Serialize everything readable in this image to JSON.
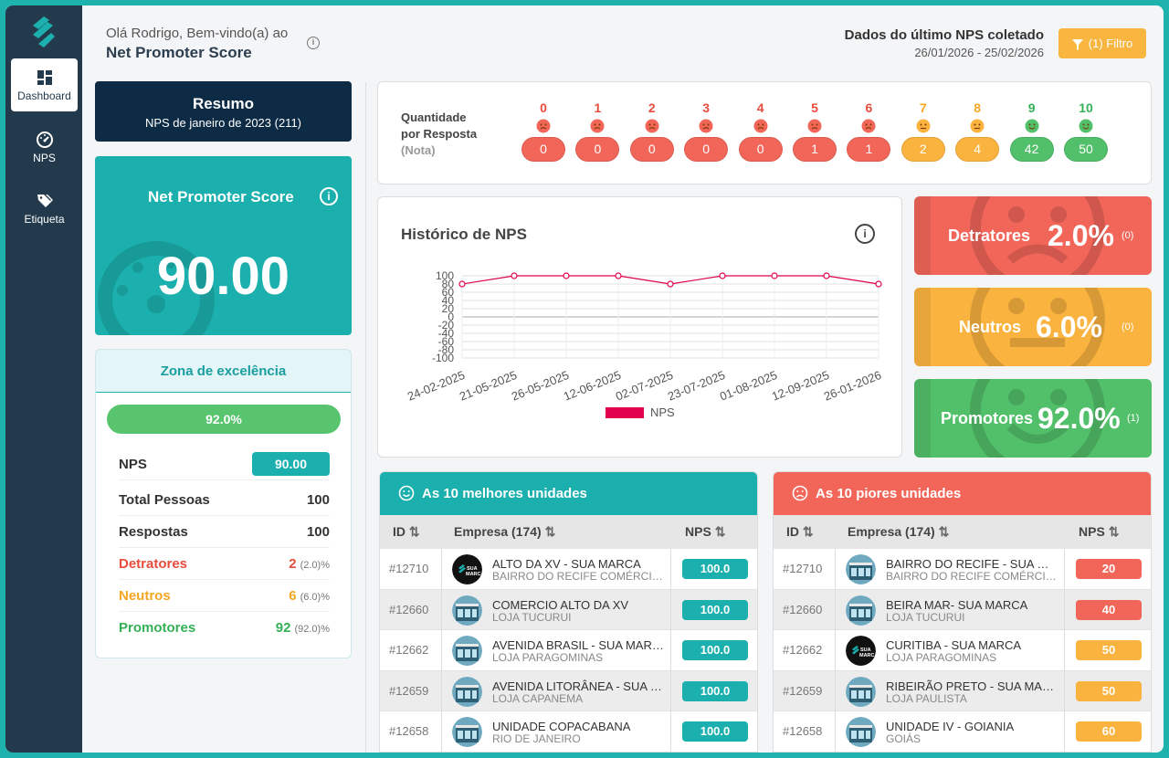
{
  "sidebar": {
    "items": [
      {
        "label": "Dashboard",
        "icon": "dashboard-icon"
      },
      {
        "label": "NPS",
        "icon": "gauge-icon"
      },
      {
        "label": "Etiqueta",
        "icon": "tag-icon"
      }
    ]
  },
  "header": {
    "greeting": "Olá Rodrigo, Bem-vindo(a) ao",
    "title": "Net Promoter Score",
    "last_nps_title": "Dados do último NPS coletado",
    "last_nps_range": "26/01/2026 - 25/02/2026",
    "filter_label": "(1) Filtro"
  },
  "resumo": {
    "title": "Resumo",
    "subtitle": "NPS de janeiro de 2023 (211)"
  },
  "nps_card": {
    "title": "Net Promoter Score",
    "value": "90.00",
    "info": "i"
  },
  "zona": {
    "title": "Zona de excelência",
    "progress_label": "92.0%",
    "progress": 0.92,
    "rows": {
      "nps": {
        "label": "NPS",
        "value": "90.00"
      },
      "total": {
        "label": "Total Pessoas",
        "value": "100"
      },
      "respostas": {
        "label": "Respostas",
        "value": "100"
      },
      "detratores": {
        "label": "Detratores",
        "value": "2",
        "pct": "(2.0)%"
      },
      "neutros": {
        "label": "Neutros",
        "value": "6",
        "pct": "(6.0)%"
      },
      "promotores": {
        "label": "Promotores",
        "value": "92",
        "pct": "(92.0)%"
      }
    }
  },
  "quantidade": {
    "label_line1": "Quantidade",
    "label_line2": "por Resposta",
    "label_line3": "(Nota)",
    "notes": [
      {
        "note": "0",
        "count": "0",
        "group": "red"
      },
      {
        "note": "1",
        "count": "0",
        "group": "red"
      },
      {
        "note": "2",
        "count": "0",
        "group": "red"
      },
      {
        "note": "3",
        "count": "0",
        "group": "red"
      },
      {
        "note": "4",
        "count": "0",
        "group": "red"
      },
      {
        "note": "5",
        "count": "1",
        "group": "red"
      },
      {
        "note": "6",
        "count": "1",
        "group": "red"
      },
      {
        "note": "7",
        "count": "2",
        "group": "yellow"
      },
      {
        "note": "8",
        "count": "4",
        "group": "yellow"
      },
      {
        "note": "9",
        "count": "42",
        "group": "green"
      },
      {
        "note": "10",
        "count": "50",
        "group": "green"
      }
    ]
  },
  "historico": {
    "title": "Histórico de NPS",
    "info": "i"
  },
  "chart_data": {
    "type": "line",
    "x": [
      "24-02-2025",
      "21-05-2025",
      "26-05-2025",
      "12-06-2025",
      "02-07-2025",
      "23-07-2025",
      "01-08-2025",
      "12-09-2025",
      "26-01-2026"
    ],
    "series": [
      {
        "name": "NPS",
        "values": [
          80,
          100,
          100,
          100,
          80,
          100,
          100,
          100,
          80
        ]
      }
    ],
    "yticks": [
      100,
      80,
      60,
      40,
      20,
      0,
      -20,
      -40,
      -60,
      -80,
      -100
    ],
    "ylim": [
      -100,
      100
    ],
    "grid": true,
    "legend": "bottom",
    "color": "#e0004d"
  },
  "stats": {
    "detratores": {
      "label": "Detratores",
      "pct": "2.0%",
      "count": "(0)",
      "color": "#f2665a"
    },
    "neutros": {
      "label": "Neutros",
      "pct": "6.0%",
      "count": "(0)",
      "color": "#fbb33f"
    },
    "promotores": {
      "label": "Promotores",
      "pct": "92.0%",
      "count": "(1)",
      "color": "#52c06a"
    }
  },
  "melhores": {
    "title": "As 10 melhores unidades",
    "headers": {
      "id": "ID",
      "empresa": "Empresa (174)",
      "nps": "NPS"
    },
    "rows": [
      {
        "id": "#12710",
        "name": "ALTO DA XV - SUA MARCA",
        "sub": "BAIRRO DO RECIFE COMÉRCIO L...",
        "nps": "100.0",
        "avatar": "brand"
      },
      {
        "id": "#12660",
        "name": "COMERCIO ALTO DA XV",
        "sub": "LOJA TUCURUI",
        "nps": "100.0",
        "avatar": "store"
      },
      {
        "id": "#12662",
        "name": "AVENIDA BRASIL - SUA MARCA",
        "sub": "LOJA PARAGOMINAS",
        "nps": "100.0",
        "avatar": "store"
      },
      {
        "id": "#12659",
        "name": "AVENIDA LITORÂNEA - SUA M...",
        "sub": "LOJA CAPANEMA",
        "nps": "100.0",
        "avatar": "store"
      },
      {
        "id": "#12658",
        "name": "UNIDADE COPACABANA",
        "sub": "RIO DE JANEIRO",
        "nps": "100.0",
        "avatar": "store"
      }
    ]
  },
  "piores": {
    "title": "As 10 piores unidades",
    "headers": {
      "id": "ID",
      "empresa": "Empresa (174)",
      "nps": "NPS"
    },
    "rows": [
      {
        "id": "#12710",
        "name": "BAIRRO DO RECIFE - SUA MA...",
        "sub": "BAIRRO DO RECIFE COMÉRCIO L...",
        "nps": "20",
        "color": "#f2665a",
        "avatar": "store"
      },
      {
        "id": "#12660",
        "name": "BEIRA MAR- SUA MARCA",
        "sub": "LOJA TUCURUI",
        "nps": "40",
        "color": "#f2665a",
        "avatar": "store"
      },
      {
        "id": "#12662",
        "name": "CURITIBA - SUA MARCA",
        "sub": "LOJA PARAGOMINAS",
        "nps": "50",
        "color": "#fbb33f",
        "avatar": "brand"
      },
      {
        "id": "#12659",
        "name": "RIBEIRÃO PRETO - SUA MARCA",
        "sub": "LOJA PAULISTA",
        "nps": "50",
        "color": "#fbb33f",
        "avatar": "store"
      },
      {
        "id": "#12658",
        "name": "UNIDADE IV - GOIANIA",
        "sub": "GOIÁS",
        "nps": "60",
        "color": "#fbb33f",
        "avatar": "store"
      }
    ]
  },
  "colors": {
    "teal": "#1bb0ad",
    "navy": "#0d2b45",
    "sidebar": "#233a4d",
    "red": "#f2665a",
    "yellow": "#fbb33f",
    "green": "#52c06a"
  }
}
